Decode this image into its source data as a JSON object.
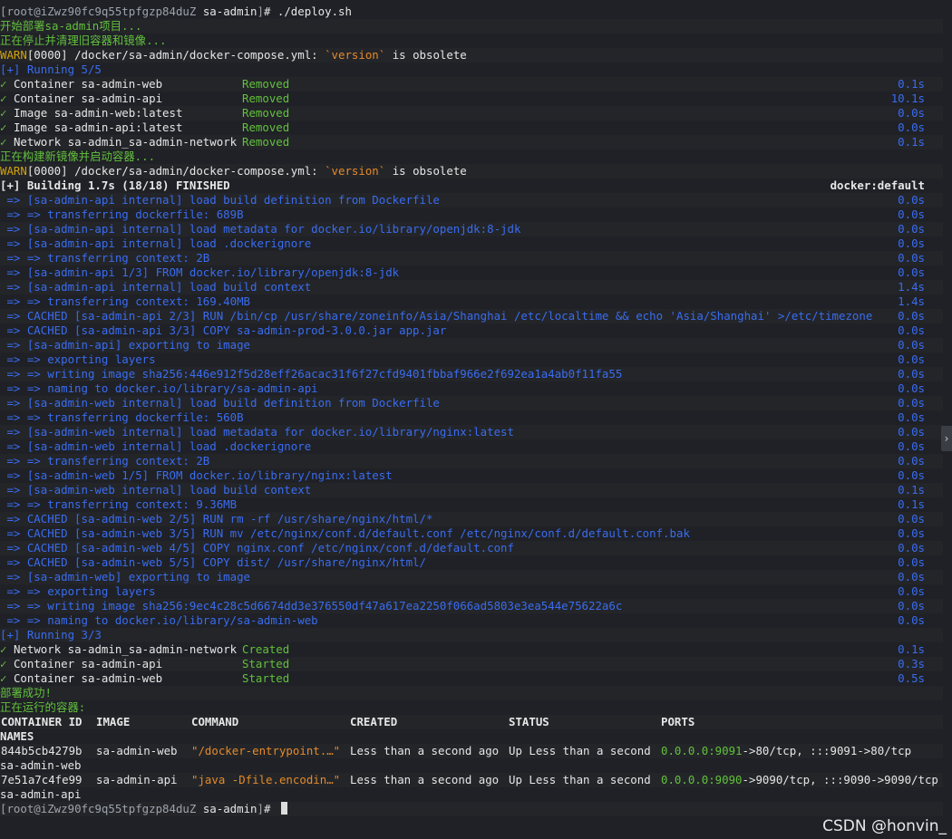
{
  "prompt": {
    "user_host": "root@iZwz90fc9q55tpfgzp84duZ",
    "dir": "sa-admin",
    "command": "./deploy.sh"
  },
  "msgs": {
    "start": "开始部署sa-admin项目...",
    "stop": "正在停止并清理旧容器和镜像...",
    "build": "正在构建新镜像并启动容器...",
    "success": "部署成功!",
    "running": "正在运行的容器:"
  },
  "warn": {
    "label": "WARN",
    "code": "[0000]",
    "text_pre": " /docker/sa-admin/docker-compose.yml: ",
    "quoted": "`version`",
    "text_post": " is obsolete"
  },
  "running1": "[+] Running 5/5",
  "removed_rows": [
    {
      "name": "Container sa-admin-web",
      "status": "Removed",
      "time": "0.1s"
    },
    {
      "name": "Container sa-admin-api",
      "status": "Removed",
      "time": "10.1s"
    },
    {
      "name": "Image sa-admin-web:latest",
      "status": "Removed",
      "time": "0.0s"
    },
    {
      "name": "Image sa-admin-api:latest",
      "status": "Removed",
      "time": "0.0s"
    },
    {
      "name": "Network sa-admin_sa-admin-network",
      "status": "Removed",
      "time": "0.1s"
    }
  ],
  "check": "✓",
  "building": {
    "text": "[+] Building 1.7s (18/18) FINISHED",
    "right": "docker:default"
  },
  "build_steps": [
    {
      "text": " => [sa-admin-api internal] load build definition from Dockerfile",
      "time": "0.0s"
    },
    {
      "text": " => => transferring dockerfile: 689B",
      "time": "0.0s"
    },
    {
      "text": " => [sa-admin-api internal] load metadata for docker.io/library/openjdk:8-jdk",
      "time": "0.0s"
    },
    {
      "text": " => [sa-admin-api internal] load .dockerignore",
      "time": "0.0s"
    },
    {
      "text": " => => transferring context: 2B",
      "time": "0.0s"
    },
    {
      "text": " => [sa-admin-api 1/3] FROM docker.io/library/openjdk:8-jdk",
      "time": "0.0s"
    },
    {
      "text": " => [sa-admin-api internal] load build context",
      "time": "1.4s"
    },
    {
      "text": " => => transferring context: 169.40MB",
      "time": "1.4s"
    },
    {
      "text": " => CACHED [sa-admin-api 2/3] RUN /bin/cp /usr/share/zoneinfo/Asia/Shanghai /etc/localtime && echo 'Asia/Shanghai' >/etc/timezone",
      "time": "0.0s"
    },
    {
      "text": " => CACHED [sa-admin-api 3/3] COPY sa-admin-prod-3.0.0.jar app.jar",
      "time": "0.0s"
    },
    {
      "text": " => [sa-admin-api] exporting to image",
      "time": "0.0s"
    },
    {
      "text": " => => exporting layers",
      "time": "0.0s"
    },
    {
      "text": " => => writing image sha256:446e912f5d28eff26acac31f6f27cfd9401fbbaf966e2f692ea1a4ab0f11fa55",
      "time": "0.0s"
    },
    {
      "text": " => => naming to docker.io/library/sa-admin-api",
      "time": "0.0s"
    },
    {
      "text": " => [sa-admin-web internal] load build definition from Dockerfile",
      "time": "0.0s"
    },
    {
      "text": " => => transferring dockerfile: 560B",
      "time": "0.0s"
    },
    {
      "text": " => [sa-admin-web internal] load metadata for docker.io/library/nginx:latest",
      "time": "0.0s"
    },
    {
      "text": " => [sa-admin-web internal] load .dockerignore",
      "time": "0.0s"
    },
    {
      "text": " => => transferring context: 2B",
      "time": "0.0s"
    },
    {
      "text": " => [sa-admin-web 1/5] FROM docker.io/library/nginx:latest",
      "time": "0.0s"
    },
    {
      "text": " => [sa-admin-web internal] load build context",
      "time": "0.1s"
    },
    {
      "text": " => => transferring context: 9.36MB",
      "time": "0.1s"
    },
    {
      "text": " => CACHED [sa-admin-web 2/5] RUN rm -rf /usr/share/nginx/html/*",
      "time": "0.0s"
    },
    {
      "text": " => CACHED [sa-admin-web 3/5] RUN mv /etc/nginx/conf.d/default.conf /etc/nginx/conf.d/default.conf.bak",
      "time": "0.0s"
    },
    {
      "text": " => CACHED [sa-admin-web 4/5] COPY nginx.conf /etc/nginx/conf.d/default.conf",
      "time": "0.0s"
    },
    {
      "text": " => CACHED [sa-admin-web 5/5] COPY dist/ /usr/share/nginx/html/",
      "time": "0.0s"
    },
    {
      "text": " => [sa-admin-web] exporting to image",
      "time": "0.0s"
    },
    {
      "text": " => => exporting layers",
      "time": "0.0s"
    },
    {
      "text": " => => writing image sha256:9ec4c28c5d6674dd3e376550df47a617ea2250f066ad5803e3ea544e75622a6c",
      "time": "0.0s"
    },
    {
      "text": " => => naming to docker.io/library/sa-admin-web",
      "time": "0.0s"
    }
  ],
  "running2": "[+] Running 3/3",
  "started_rows": [
    {
      "name": "Network sa-admin_sa-admin-network",
      "status": "Created",
      "time": "0.1s"
    },
    {
      "name": "Container sa-admin-api",
      "status": "Started",
      "time": "0.3s"
    },
    {
      "name": "Container sa-admin-web",
      "status": "Started",
      "time": "0.5s"
    }
  ],
  "ps": {
    "headers": [
      "CONTAINER ID",
      "IMAGE",
      "COMMAND",
      "CREATED",
      "STATUS",
      "PORTS"
    ],
    "names_header": "NAMES",
    "rows": [
      {
        "id": "844b5cb4279b",
        "image": "sa-admin-web",
        "command": "\"/docker-entrypoint.…\"",
        "created": "Less than a second ago",
        "status": "Up Less than a second",
        "port_green": "0.0.0.0:9091",
        "port_rest": "->80/tcp, :::9091->80/tcp",
        "name": "sa-admin-web"
      },
      {
        "id": "7e51a7c4fe99",
        "image": "sa-admin-api",
        "command": "\"java -Dfile.encodin…\"",
        "created": "Less than a second ago",
        "status": "Up Less than a second",
        "port_green": "0.0.0.0:9090",
        "port_rest": "->9090/tcp, :::9090->9090/tcp",
        "name": "sa-admin-api"
      }
    ]
  },
  "watermark": "CSDN @honvin_",
  "scroll_arrow": "›"
}
